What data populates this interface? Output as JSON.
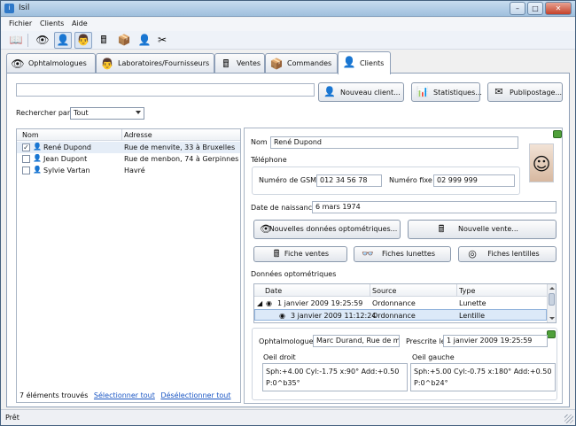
{
  "window": {
    "title": "Isil"
  },
  "menu": [
    "Fichier",
    "Clients",
    "Aide"
  ],
  "tabs": [
    {
      "label": "Ophtalmologues",
      "icon": "eye-icon"
    },
    {
      "label": "Laboratoires/Fournisseurs",
      "icon": "doctor-icon"
    },
    {
      "label": "Ventes",
      "icon": "cash-register-icon"
    },
    {
      "label": "Commandes",
      "icon": "delivery-icon"
    },
    {
      "label": "Clients",
      "icon": "person-icon"
    }
  ],
  "search": {
    "value": "",
    "placeholder": ""
  },
  "buttons": {
    "new_client": "Nouveau client...",
    "stats": "Statistiques...",
    "mailing": "Publipostage..."
  },
  "search_by": {
    "label": "Rechercher par",
    "selected": "Tout"
  },
  "client_list": {
    "columns": [
      "Nom",
      "Adresse"
    ],
    "rows": [
      {
        "checked": true,
        "name": "René Dupond",
        "address": "Rue de menvite, 33 à Bruxelles"
      },
      {
        "checked": false,
        "name": "Jean Dupont",
        "address": "Rue de menbon, 74 à Gerpinnes"
      },
      {
        "checked": false,
        "name": "Sylvie Vartan",
        "address": "Havré"
      }
    ],
    "found_text": "7 éléments trouvés",
    "select_all": "Sélectionner tout",
    "deselect_all": "Désélectionner tout"
  },
  "detail": {
    "name_label": "Nom",
    "name_value": "René Dupond",
    "phone_section": "Téléphone",
    "gsm_label": "Numéro de GSM",
    "gsm_value": "012 34 56 78",
    "fixed_label": "Numéro fixe",
    "fixed_value": "02 999 999",
    "birth_label": "Date de naissance",
    "birth_value": "6 mars 1974",
    "new_optometric": "Nouvelles données optométriques...",
    "new_sale": "Nouvelle vente...",
    "sales_sheet": "Fiche ventes",
    "glasses_sheet": "Fiches lunettes",
    "lenses_sheet": "Fiches lentilles",
    "optometric_section": "Données optométriques",
    "grid_columns": [
      "Date",
      "Source",
      "Type"
    ],
    "grid_rows": [
      {
        "date": "1 janvier 2009 19:25:59",
        "source": "Ordonnance",
        "type": "Lunette"
      },
      {
        "date": "3 janvier 2009 11:12:24",
        "source": "Ordonnance",
        "type": "Lentille"
      }
    ],
    "ophtalmo_label": "Ophtalmologue",
    "ophtalmo_value": "Marc Durand, Rue de menh",
    "prescribed_label": "Prescrite le",
    "prescribed_value": "1 janvier 2009 19:25:59",
    "right_eye_label": "Oeil droit",
    "right_eye_line1": "Sph:+4.00 Cyl:-1.75 x:90° Add:+0.50",
    "right_eye_line2": "P:0^b35°",
    "left_eye_label": "Oeil gauche",
    "left_eye_line1": "Sph:+5.00 Cyl:-0.75 x:180° Add:+0.50",
    "left_eye_line2": "P:0^b24°"
  },
  "status": "Prêt"
}
